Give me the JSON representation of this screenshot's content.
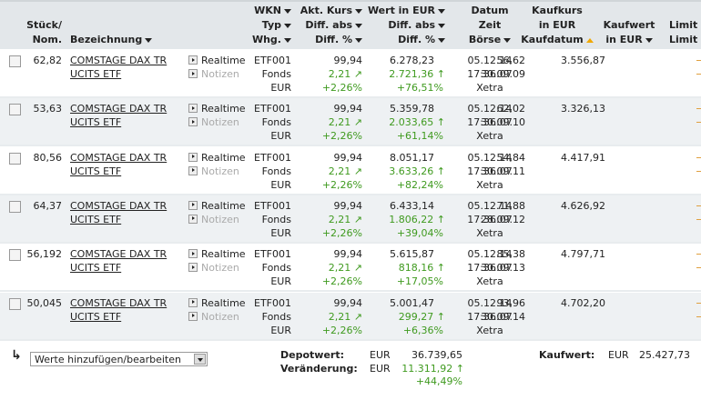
{
  "header": {
    "stueck": [
      "Stück/",
      "Nom."
    ],
    "bezeichnung": "Bezeichnung",
    "wkn": [
      "WKN",
      "Typ",
      "Whg."
    ],
    "kurs": [
      "Akt. Kurs",
      "Diff. abs",
      "Diff. %"
    ],
    "wert": [
      "Wert in EUR",
      "Diff. abs",
      "Diff. %"
    ],
    "datum": [
      "Datum",
      "Zeit",
      "Börse"
    ],
    "kaufkurs": [
      "Kaufkurs",
      "in EUR",
      "Kaufdatum"
    ],
    "kaufwert": [
      "Kaufwert",
      "in EUR"
    ],
    "limit": [
      "Limit",
      "Limit"
    ]
  },
  "rows": [
    {
      "stueck": "62,82",
      "name1": "COMSTAGE DAX TR",
      "name2": "UCITS ETF",
      "realtime": "Realtime",
      "notizen": "Notizen",
      "wkn": "ETF001",
      "typ": "Fonds",
      "whg": "EUR",
      "kurs": "99,94",
      "kurs_diff": "2,21",
      "kurs_pct": "+2,26%",
      "wert": "6.278,23",
      "wert_diff": "2.721,36",
      "wert_pct": "+76,51%",
      "datum": "05.12.14",
      "zeit": "17:36:07",
      "boerse": "Xetra",
      "kaufkurs": "56,62",
      "kaufdatum": "30.09.09",
      "kaufwert": "3.556,87"
    },
    {
      "stueck": "53,63",
      "name1": "COMSTAGE DAX TR",
      "name2": "UCITS ETF",
      "realtime": "Realtime",
      "notizen": "Notizen",
      "wkn": "ETF001",
      "typ": "Fonds",
      "whg": "EUR",
      "kurs": "99,94",
      "kurs_diff": "2,21",
      "kurs_pct": "+2,26%",
      "wert": "5.359,78",
      "wert_diff": "2.033,65",
      "wert_pct": "+61,14%",
      "datum": "05.12.14",
      "zeit": "17:36:07",
      "boerse": "Xetra",
      "kaufkurs": "62,02",
      "kaufdatum": "30.09.10",
      "kaufwert": "3.326,13"
    },
    {
      "stueck": "80,56",
      "name1": "COMSTAGE DAX TR",
      "name2": "UCITS ETF",
      "realtime": "Realtime",
      "notizen": "Notizen",
      "wkn": "ETF001",
      "typ": "Fonds",
      "whg": "EUR",
      "kurs": "99,94",
      "kurs_diff": "2,21",
      "kurs_pct": "+2,26%",
      "wert": "8.051,17",
      "wert_diff": "3.633,26",
      "wert_pct": "+82,24%",
      "datum": "05.12.14",
      "zeit": "17:36:07",
      "boerse": "Xetra",
      "kaufkurs": "54,84",
      "kaufdatum": "30.09.11",
      "kaufwert": "4.417,91"
    },
    {
      "stueck": "64,37",
      "name1": "COMSTAGE DAX TR",
      "name2": "UCITS ETF",
      "realtime": "Realtime",
      "notizen": "Notizen",
      "wkn": "ETF001",
      "typ": "Fonds",
      "whg": "EUR",
      "kurs": "99,94",
      "kurs_diff": "2,21",
      "kurs_pct": "+2,26%",
      "wert": "6.433,14",
      "wert_diff": "1.806,22",
      "wert_pct": "+39,04%",
      "datum": "05.12.14",
      "zeit": "17:36:07",
      "boerse": "Xetra",
      "kaufkurs": "71,88",
      "kaufdatum": "28.09.12",
      "kaufwert": "4.626,92"
    },
    {
      "stueck": "56,192",
      "name1": "COMSTAGE DAX TR",
      "name2": "UCITS ETF",
      "realtime": "Realtime",
      "notizen": "Notizen",
      "wkn": "ETF001",
      "typ": "Fonds",
      "whg": "EUR",
      "kurs": "99,94",
      "kurs_diff": "2,21",
      "kurs_pct": "+2,26%",
      "wert": "5.615,87",
      "wert_diff": "818,16",
      "wert_pct": "+17,05%",
      "datum": "05.12.14",
      "zeit": "17:36:07",
      "boerse": "Xetra",
      "kaufkurs": "85,38",
      "kaufdatum": "30.09.13",
      "kaufwert": "4.797,71"
    },
    {
      "stueck": "50,045",
      "name1": "COMSTAGE DAX TR",
      "name2": "UCITS ETF",
      "realtime": "Realtime",
      "notizen": "Notizen",
      "wkn": "ETF001",
      "typ": "Fonds",
      "whg": "EUR",
      "kurs": "99,94",
      "kurs_diff": "2,21",
      "kurs_pct": "+2,26%",
      "wert": "5.001,47",
      "wert_diff": "299,27",
      "wert_pct": "+6,36%",
      "datum": "05.12.14",
      "zeit": "17:36:07",
      "boerse": "Xetra",
      "kaufkurs": "93,96",
      "kaufdatum": "30.09.14",
      "kaufwert": "4.702,20"
    }
  ],
  "footer": {
    "select_value": "Werte hinzufügen/bearbeiten",
    "depotwert_label": "Depotwert:",
    "depotwert_cur": "EUR",
    "depotwert": "36.739,65",
    "veraenderung_label": "Veränderung:",
    "veraenderung_cur": "EUR",
    "veraenderung": "11.311,92",
    "veraenderung_pct": "+44,49%",
    "kaufwert_label": "Kaufwert:",
    "kaufwert_cur": "EUR",
    "kaufwert": "25.427,73"
  },
  "colors": {
    "positive": "#3f9a1f",
    "header_bg": "#e3e7ea",
    "alt_row": "#eef1f3",
    "sort_active": "#f0a800"
  }
}
